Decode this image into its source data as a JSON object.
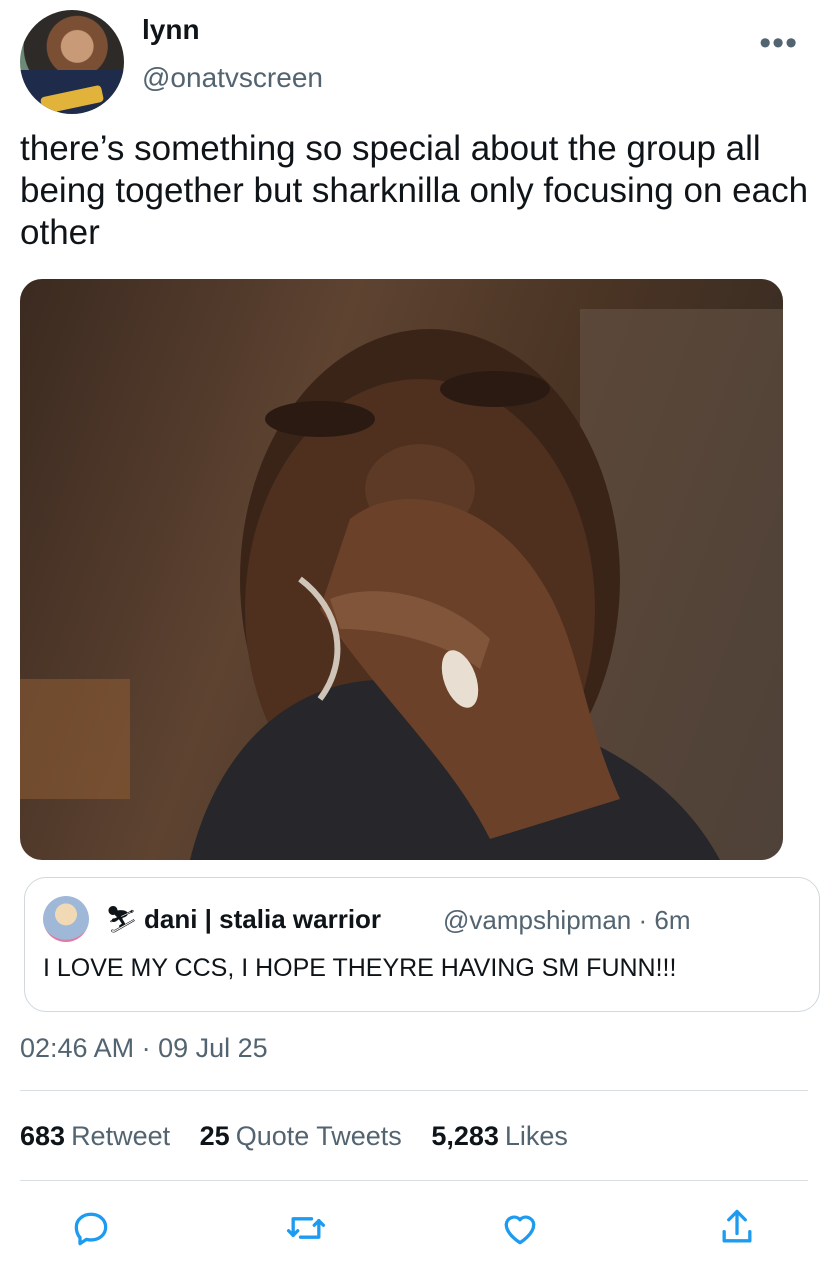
{
  "author": {
    "display_name": "lynn",
    "handle": "@onatvscreen"
  },
  "tweet": {
    "text": "there’s something so special about the group all being together but sharknilla only focusing on each other",
    "media_icon": "crying-man-photo"
  },
  "quoted_tweet": {
    "emoji": "⛷",
    "display_name": "dani | stalia warrior",
    "handle": "@vampshipman",
    "separator": "·",
    "time": "6m",
    "text": "I LOVE MY CCS, I HOPE THEYRE HAVING SM FUNN!!!"
  },
  "timestamp": "02:46 AM · 09 Jul 25",
  "stats": {
    "retweets_count": "683",
    "retweets_label": "Retweet",
    "quotes_count": "25",
    "quotes_label": "Quote Tweets",
    "likes_count": "5,283",
    "likes_label": "Likes"
  },
  "actions": [
    "reply-icon",
    "retweet-icon",
    "like-icon",
    "share-icon"
  ],
  "colors": {
    "text": "#0f1419",
    "secondary": "#536471",
    "border": "#cfd9de",
    "icon": "#1d9bf0"
  }
}
